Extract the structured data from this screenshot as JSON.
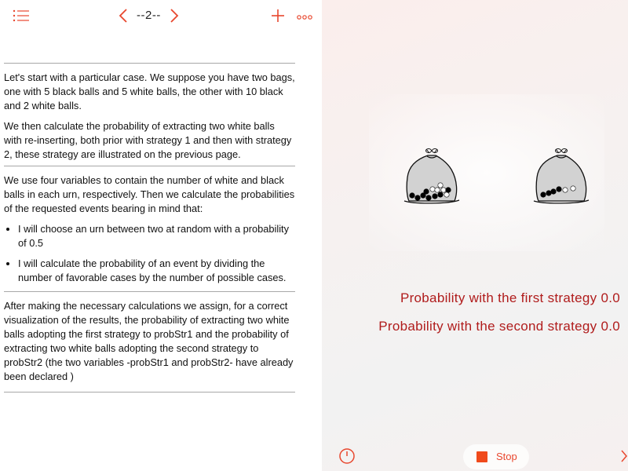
{
  "header": {
    "page_label": "--2--"
  },
  "document": {
    "paragraph_1": "Let's start with a particular case. We suppose you have two bags, one with 5 black balls and 5 white balls, the other with 10 black and 2 white balls.",
    "paragraph_2": "We then calculate the probability of extracting two white balls with re-inserting, both prior with strategy 1 and then with strategy 2, these strategy are illustrated on the previous page.",
    "paragraph_3": "We use four variables to contain the number of white and black balls in each urn, respectively. Then we calculate the probabilities of the requested events bearing in mind that:",
    "bullets": [
      "I will choose an urn between two at random with a probability of 0.5",
      "I will calculate the probability of an event by dividing the number of favorable cases by the number of possible cases."
    ],
    "paragraph_4": "After making the necessary calculations we assign, for a correct visualization of the results, the probability of extracting two white balls adopting the first strategy to probStr1 and the probability of extracting two white balls adopting the second strategy to probStr2 (the two variables -probStr1 and probStr2- have already been declared )"
  },
  "results": {
    "first_strategy": "Probability with the first strategy 0.0",
    "second_strategy": "Probability with the second strategy 0.0"
  },
  "toolbar": {
    "stop_label": "Stop"
  },
  "icons": {
    "list": "list-icon",
    "prev": "chevron-left-icon",
    "next": "chevron-right-icon",
    "add": "plus-icon",
    "more": "more-icon",
    "speed": "speedometer-icon",
    "stop": "stop-icon"
  },
  "colors": {
    "accent": "#e8472e",
    "result_text": "#b01c1c",
    "stop": "#f04a1b"
  }
}
